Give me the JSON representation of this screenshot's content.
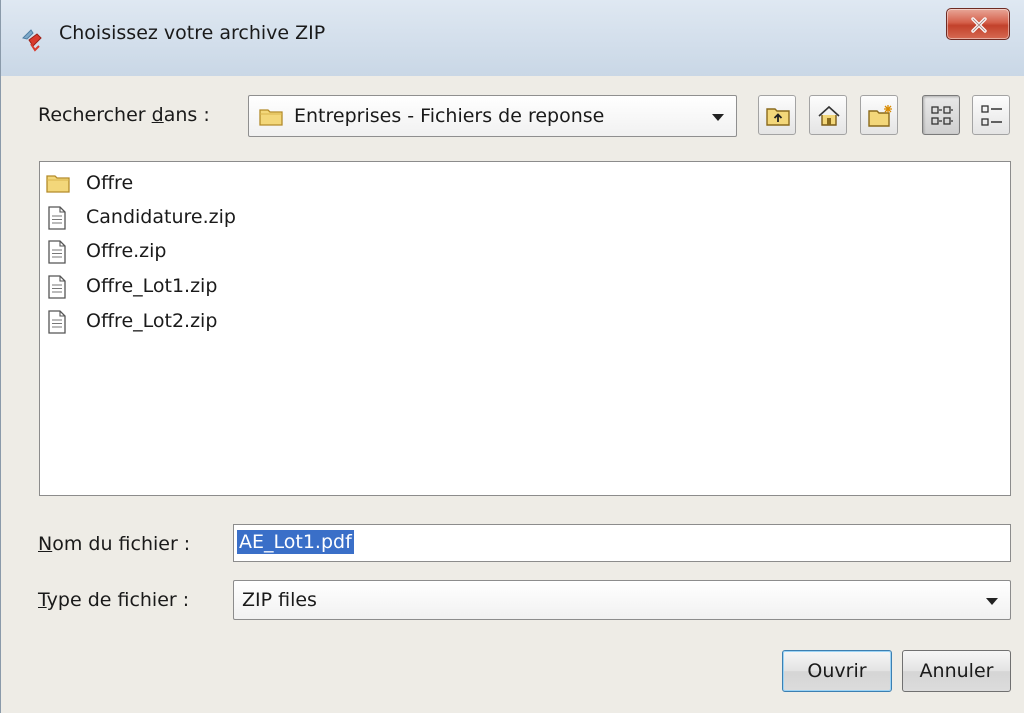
{
  "window": {
    "title": "Choisissez votre archive ZIP"
  },
  "lookin": {
    "label_before": "Rechercher ",
    "label_accel": "d",
    "label_after": "ans :",
    "value": "Entreprises - Fichiers de reponse"
  },
  "toolbar": {
    "icons": [
      "up-folder-icon",
      "home-icon",
      "new-folder-icon",
      "view-list-icon",
      "view-details-icon"
    ]
  },
  "files": [
    {
      "name": "Offre",
      "icon": "folder-icon"
    },
    {
      "name": "Candidature.zip",
      "icon": "file-icon"
    },
    {
      "name": "Offre.zip",
      "icon": "file-icon"
    },
    {
      "name": "Offre_Lot1.zip",
      "icon": "file-icon"
    },
    {
      "name": "Offre_Lot2.zip",
      "icon": "file-icon"
    }
  ],
  "filename": {
    "label_accel": "N",
    "label_after": "om du fichier :",
    "value": "AE_Lot1.pdf"
  },
  "filetype": {
    "label_accel": "T",
    "label_after": "ype de fichier :",
    "value": "ZIP files"
  },
  "buttons": {
    "open": "Ouvrir",
    "cancel": "Annuler"
  },
  "colors": {
    "selection": "#3a6fc8",
    "close_button": "#c2412b",
    "folder": "#e8c04a"
  }
}
